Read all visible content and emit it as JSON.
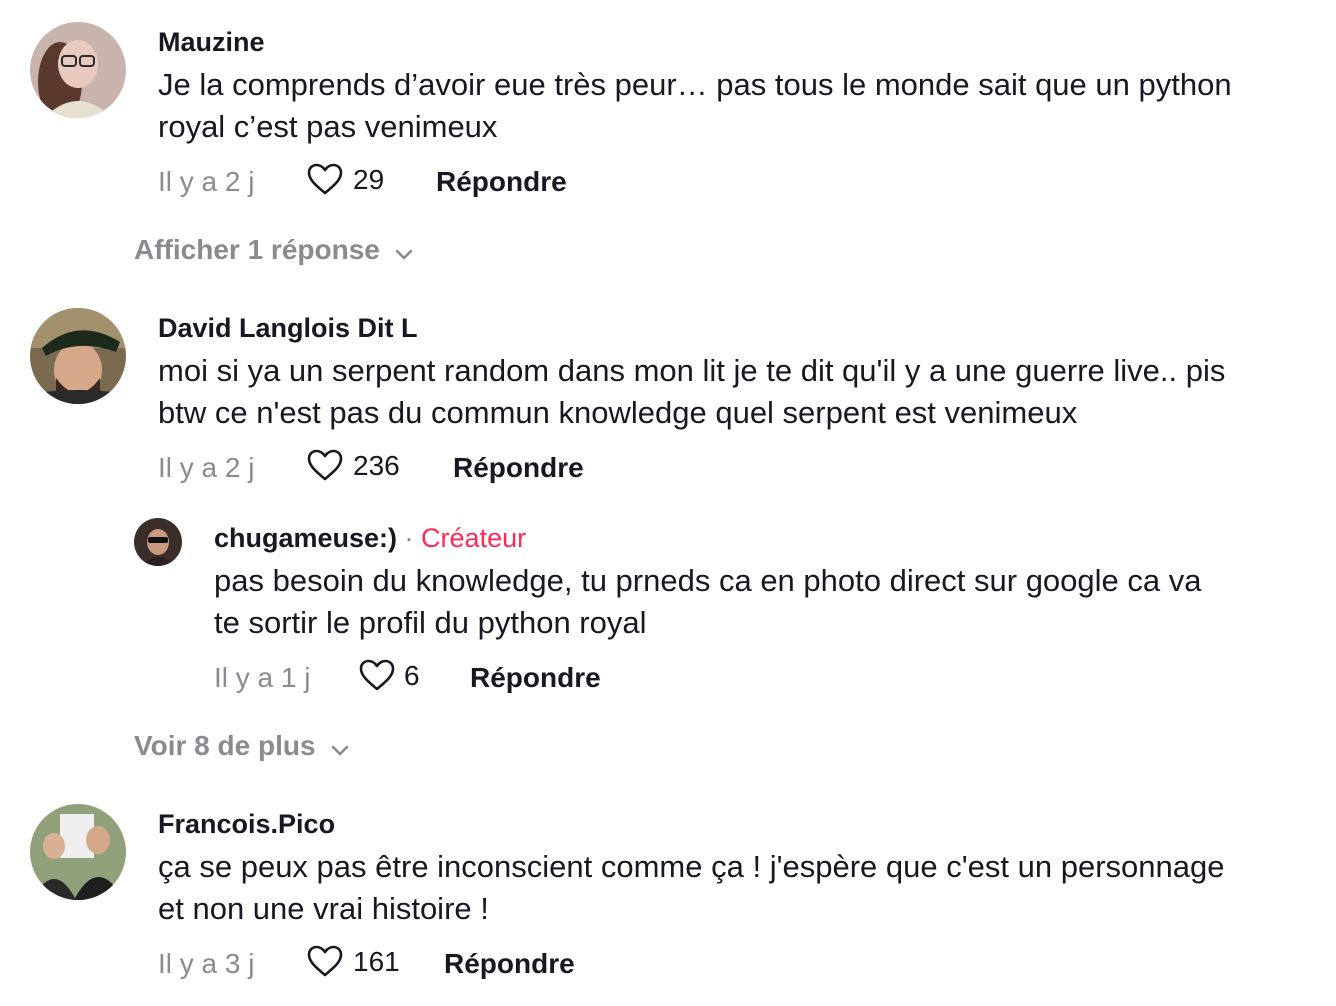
{
  "comments": [
    {
      "username": "Mauzine",
      "text_line1": "Je la comprends d’avoir eue très peur… pas tous le monde sait que un python",
      "text_line2": "royal c’est pas venimeux",
      "time": "Il y a 2 j",
      "likes": "29",
      "reply_label": "Répondre",
      "expand_label": "Afficher 1 réponse"
    },
    {
      "username": "David Langlois Dit L",
      "text_line1": "moi si ya un serpent random dans mon lit je te dit qu'il y a une guerre live.. pis",
      "text_line2": "btw ce n'est pas du commun knowledge quel serpent est venimeux",
      "time": "Il y a 2 j",
      "likes": "236",
      "reply_label": "Répondre",
      "reply": {
        "username": "chugameuse:)",
        "separator": " · ",
        "badge": "Créateur",
        "text_line1": "pas besoin du knowledge, tu prneds ca en photo direct sur google ca va",
        "text_line2": "te sortir le profil du python royal",
        "time": "Il y a 1 j",
        "likes": "6",
        "reply_label": "Répondre"
      },
      "expand_label": "Voir 8 de plus"
    },
    {
      "username": "Francois.Pico",
      "text_line1": "ça se peux pas être inconscient comme ça ! j'espère que c'est un personnage",
      "text_line2": "et non une vrai histoire !",
      "time": "Il y a 3 j",
      "likes": "161",
      "reply_label": "Répondre"
    }
  ],
  "colors": {
    "text": "#161823",
    "secondary": "#8a8b91",
    "creator_accent": "#fe2c55",
    "background": "#ffffff"
  },
  "icons": {
    "like": "heart-outline-icon",
    "expand": "chevron-down-icon"
  }
}
